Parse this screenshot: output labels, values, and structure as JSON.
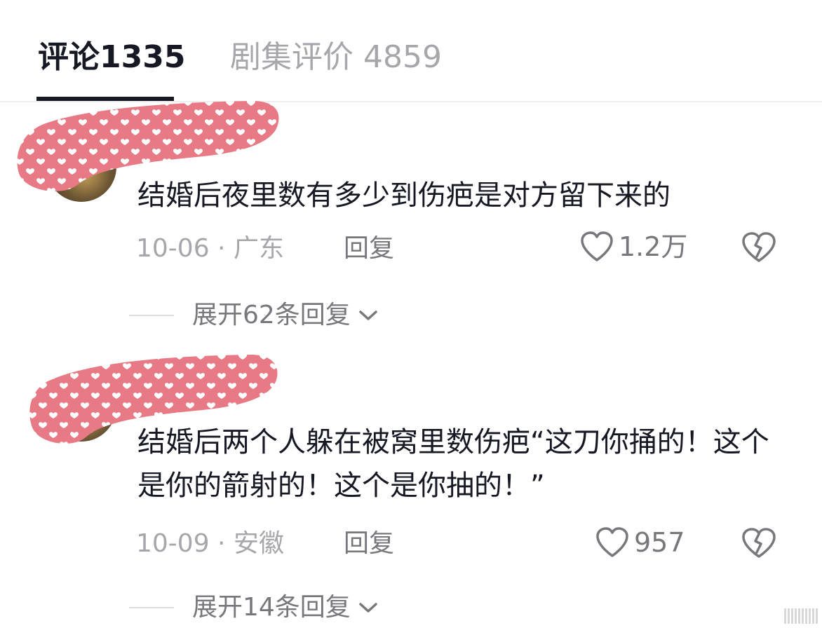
{
  "tabs": {
    "comments": "评论1335",
    "episode_reviews": "剧集评价 4859"
  },
  "comments": [
    {
      "text": "结婚后夜里数有多少到伤疤是对方留下来的",
      "date": "10-06",
      "sep": " · ",
      "location": "广东",
      "reply_label": "回复",
      "likes": "1.2万",
      "expand_label": "展开62条回复"
    },
    {
      "text": "结婚后两个人躲在被窝里数伤疤“这刀你捅的！这个是你的箭射的！这个是你抽的！”",
      "date": "10-09",
      "sep": " · ",
      "location": "安徽",
      "reply_label": "回复",
      "likes": "957",
      "expand_label": "展开14条回复"
    }
  ],
  "icons": {
    "like": "heart-outline-icon",
    "dislike": "broken-heart-icon",
    "expand": "chevron-down-icon"
  },
  "colors": {
    "primary_text": "#161823",
    "secondary_text": "#a6a7ab",
    "icon_gray": "#77787c",
    "censor_pink": "#e77a84"
  }
}
